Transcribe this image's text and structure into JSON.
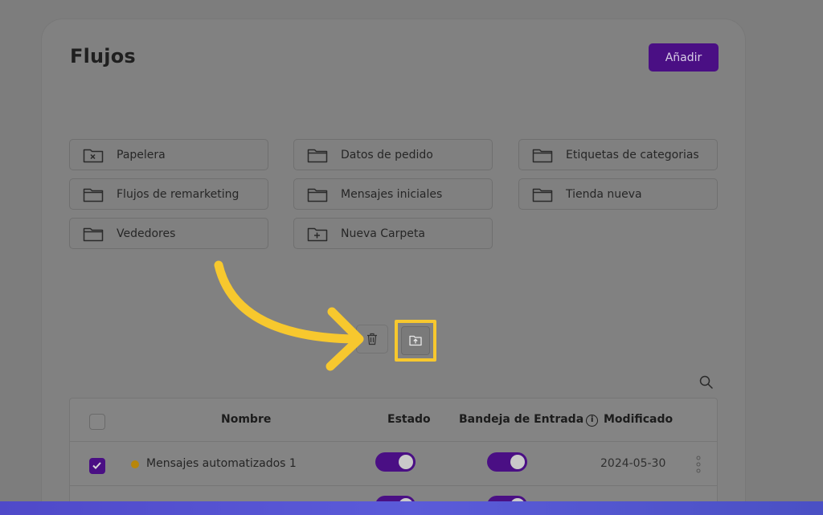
{
  "header": {
    "title": "Flujos",
    "add_label": "Añadir"
  },
  "folders": [
    {
      "label": "Papelera",
      "icon": "trash-folder-icon"
    },
    {
      "label": "Datos de pedido",
      "icon": "folder-icon"
    },
    {
      "label": "Etiquetas de categorias",
      "icon": "folder-icon"
    },
    {
      "label": "Flujos de remarketing",
      "icon": "folder-icon"
    },
    {
      "label": "Mensajes iniciales",
      "icon": "folder-icon"
    },
    {
      "label": "Tienda nueva",
      "icon": "folder-icon"
    },
    {
      "label": "Vededores",
      "icon": "folder-icon"
    },
    {
      "label": "Nueva Carpeta",
      "icon": "folder-plus-icon"
    }
  ],
  "table": {
    "columns": [
      "Nombre",
      "Estado",
      "Bandeja de Entrada",
      "Modificado"
    ],
    "rows": [
      {
        "name": "Mensajes automatizados 1",
        "estado_on": true,
        "bandeja_on": true,
        "modified": "2024-05-30",
        "checked": true
      }
    ]
  },
  "colors": {
    "accent": "#4a0f84",
    "highlight": "#f7c82e",
    "status_dot": "#b8860b"
  }
}
